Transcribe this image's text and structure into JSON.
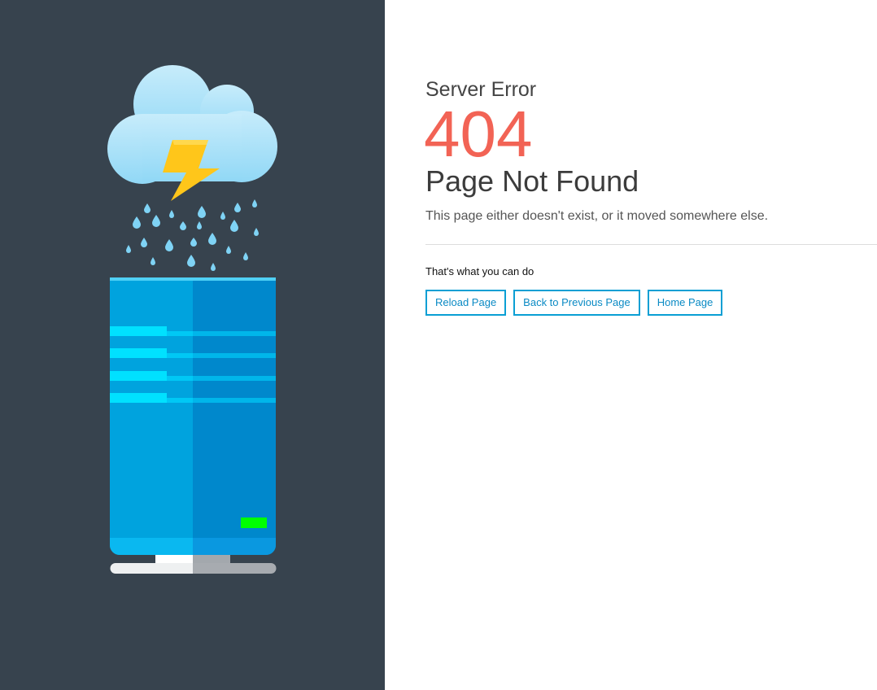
{
  "illustration": {
    "name": "server-rain-illustration",
    "colors": {
      "panel": "#37434e",
      "cloud": "#b6e6fa",
      "bolt": "#ffc61a",
      "drops": "#7fd3f5",
      "server_left": "#00a3de",
      "server_right": "#0088cc",
      "stripes": "#00e1ff",
      "indicator": "#00ff00"
    }
  },
  "main": {
    "eyebrow": "Server Error",
    "code": "404",
    "headline": "Page Not Found",
    "message": "This page either doesn't exist, or it moved somewhere else.",
    "actions_label": "That's what you can do",
    "buttons": [
      {
        "label": "Reload Page"
      },
      {
        "label": "Back to Previous Page"
      },
      {
        "label": "Home Page"
      }
    ]
  }
}
